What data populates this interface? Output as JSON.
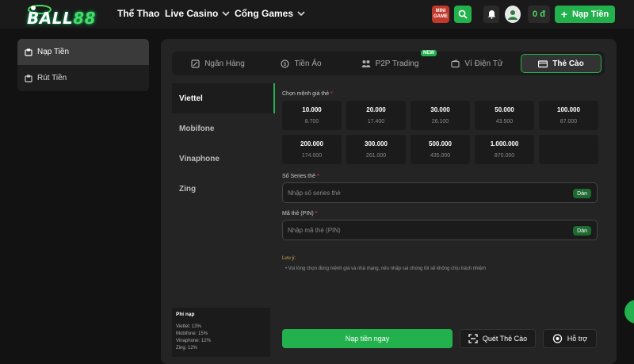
{
  "header": {
    "logo_text": "BALL",
    "logo_number": "88",
    "nav": [
      {
        "label": "Thể Thao"
      },
      {
        "label": "Live Casino"
      },
      {
        "label": "Cổng Games"
      }
    ],
    "minigame_label": "MINI GAME",
    "balance": "0 đ",
    "deposit_label": "Nạp Tiền"
  },
  "sidebar": {
    "items": [
      {
        "label": "Nạp Tiền",
        "icon": "deposit-icon",
        "active": true
      },
      {
        "label": "Rút Tiền",
        "icon": "withdraw-icon",
        "active": false
      }
    ]
  },
  "tabs": [
    {
      "label": "Ngân Hàng",
      "icon": "bank-icon"
    },
    {
      "label": "Tiền Ảo",
      "icon": "crypto-icon"
    },
    {
      "label": "P2P Trading",
      "icon": "p2p-icon",
      "badge": "NEW"
    },
    {
      "label": "Ví Điện Tử",
      "icon": "wallet-icon"
    },
    {
      "label": "Thẻ Cào",
      "icon": "card-icon",
      "active": true
    }
  ],
  "networks": [
    {
      "label": "Viettel",
      "active": true
    },
    {
      "label": "Mobifone"
    },
    {
      "label": "Vinaphone"
    },
    {
      "label": "Zing"
    }
  ],
  "form": {
    "denomination_label": "Chọn mệnh giá thẻ",
    "required_mark": "*",
    "denominations": [
      {
        "value": "10.000",
        "price": "8.700"
      },
      {
        "value": "20.000",
        "price": "17.400"
      },
      {
        "value": "30.000",
        "price": "26.100"
      },
      {
        "value": "50.000",
        "price": "43.500"
      },
      {
        "value": "100.000",
        "price": "87.000"
      },
      {
        "value": "200.000",
        "price": "174.000"
      },
      {
        "value": "300.000",
        "price": "261.000"
      },
      {
        "value": "500.000",
        "price": "435.000"
      },
      {
        "value": "1.000.000",
        "price": "870.000"
      },
      {
        "value": "",
        "price": ""
      }
    ],
    "serial_label": "Số Series thẻ",
    "serial_placeholder": "Nhập số series thẻ",
    "pin_label": "Mã thẻ (PIN)",
    "pin_placeholder": "Nhập mã thẻ (PIN)",
    "paste_label": "Dán",
    "note_title": "Lưu ý:",
    "note_text": "Vui lòng chọn đúng mệnh giá và nhà mạng, nếu nhập sai chúng tôi sẽ không chịu trách nhiệm",
    "submit_label": "Nạp tiền ngay",
    "scan_label": "Quét Thẻ Cào",
    "support_label": "Hỗ trợ"
  },
  "fees": {
    "title": "Phí nạp",
    "rows": [
      "Viettel: 13%",
      "Mobifone: 15%",
      "Vinaphone: 12%",
      "Zing: 12%"
    ]
  },
  "colors": {
    "accent": "#22b14c",
    "background": "#121212",
    "panel": "#242424"
  }
}
